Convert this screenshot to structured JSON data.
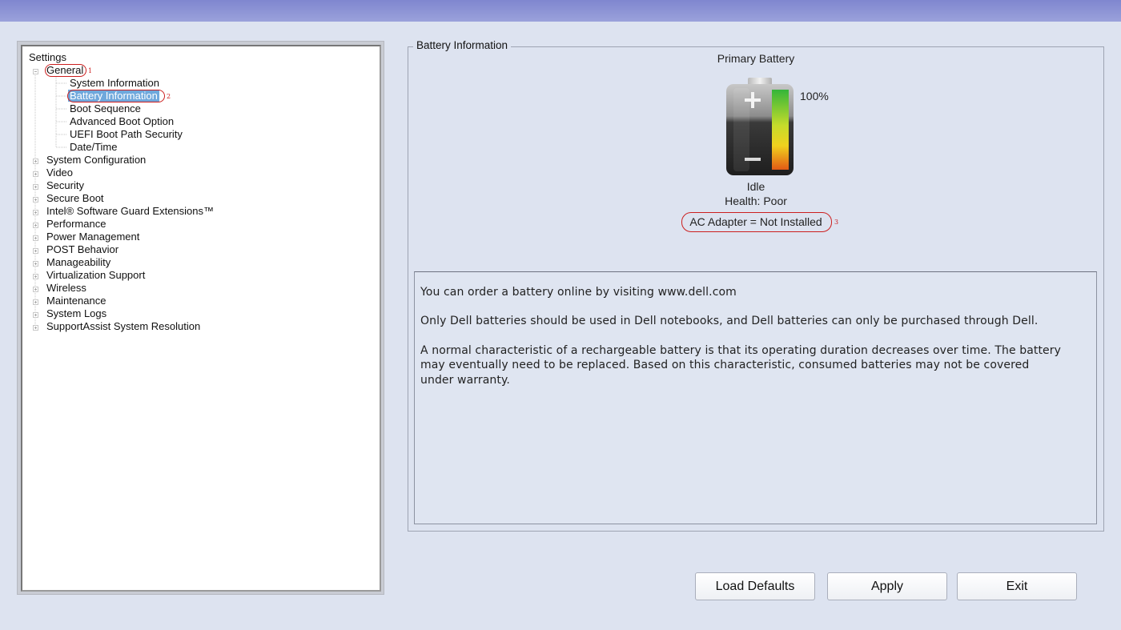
{
  "tree": {
    "root_label": "Settings",
    "general": {
      "label": "General",
      "annotation": "1",
      "children": [
        {
          "label": "System Information"
        },
        {
          "label": "Battery Information",
          "selected": true,
          "annotation": "2"
        },
        {
          "label": "Boot Sequence"
        },
        {
          "label": "Advanced Boot Option"
        },
        {
          "label": "UEFI Boot Path Security"
        },
        {
          "label": "Date/Time"
        }
      ]
    },
    "categories": [
      "System Configuration",
      "Video",
      "Security",
      "Secure Boot",
      "Intel® Software Guard Extensions™",
      "Performance",
      "Power Management",
      "POST Behavior",
      "Manageability",
      "Virtualization Support",
      "Wireless",
      "Maintenance",
      "System Logs",
      "SupportAssist System Resolution"
    ]
  },
  "battery": {
    "group_title": "Battery Information",
    "heading": "Primary Battery",
    "charge_percent": "100%",
    "charge_level": 1.0,
    "state": "Idle",
    "health": "Health: Poor",
    "ac_adapter": "AC Adapter = Not Installed",
    "ac_annotation": "3"
  },
  "info": {
    "line1": "You can order a battery online by visiting www.dell.com",
    "line2": "Only Dell batteries should be used in Dell notebooks, and Dell batteries can only be purchased through Dell.",
    "line3": "A normal characteristic of a rechargeable battery is that its operating duration decreases over time. The battery may eventually need to be replaced. Based on this characteristic, consumed batteries may not be covered under warranty."
  },
  "buttons": {
    "load_defaults": "Load Defaults",
    "apply": "Apply",
    "exit": "Exit"
  },
  "colors": {
    "annotation": "#cc1f1f",
    "selection": "#6fa8dc",
    "topbar": "#8a91d4"
  },
  "icons": {
    "expand": "tree-expand-icon",
    "collapse": "tree-collapse-icon",
    "battery": "battery-icon"
  }
}
